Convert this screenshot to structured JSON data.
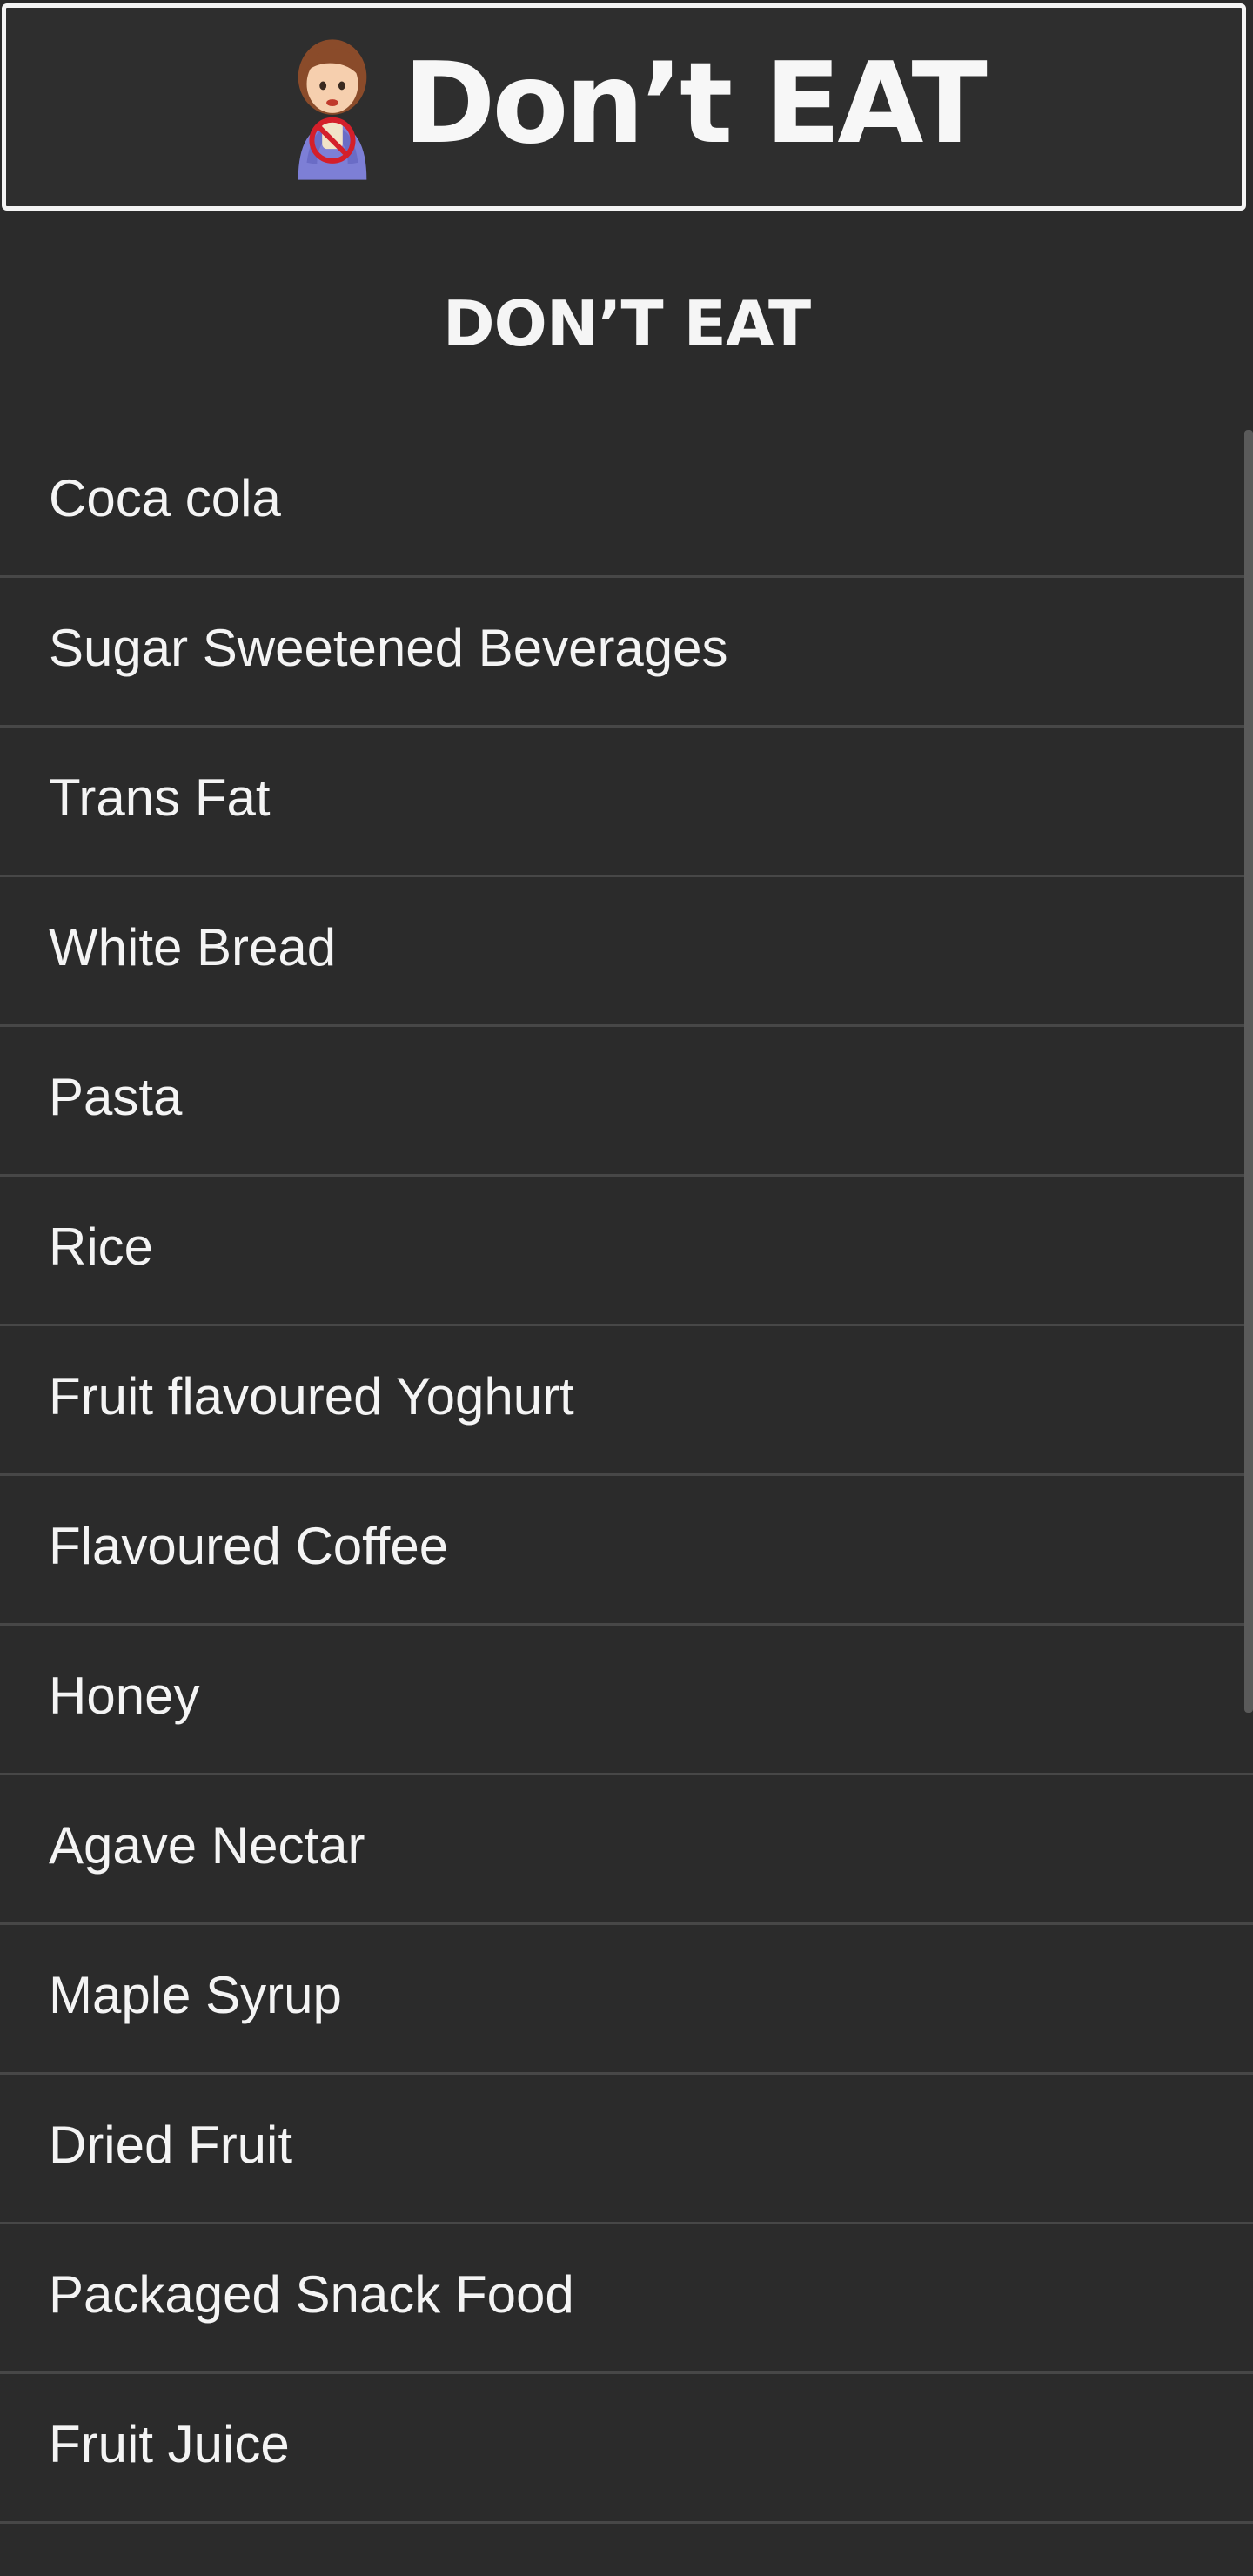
{
  "header": {
    "title": "Don’t EAT",
    "logo_icon": "no-eating-girl-icon"
  },
  "section": {
    "title": "DON’T EAT"
  },
  "items": [
    {
      "label": "Coca cola"
    },
    {
      "label": "Sugar Sweetened Beverages"
    },
    {
      "label": "Trans Fat"
    },
    {
      "label": "White Bread"
    },
    {
      "label": "Pasta"
    },
    {
      "label": "Rice"
    },
    {
      "label": "Fruit flavoured Yoghurt"
    },
    {
      "label": "Flavoured Coffee"
    },
    {
      "label": "Honey"
    },
    {
      "label": "Agave Nectar"
    },
    {
      "label": "Maple Syrup"
    },
    {
      "label": "Dried Fruit"
    },
    {
      "label": "Packaged Snack Food"
    },
    {
      "label": "Fruit Juice"
    }
  ],
  "colors": {
    "background": "#2b2b2b",
    "text": "#f4f4f4",
    "divider": "#474747",
    "banner_border": "#f4f4f4"
  }
}
